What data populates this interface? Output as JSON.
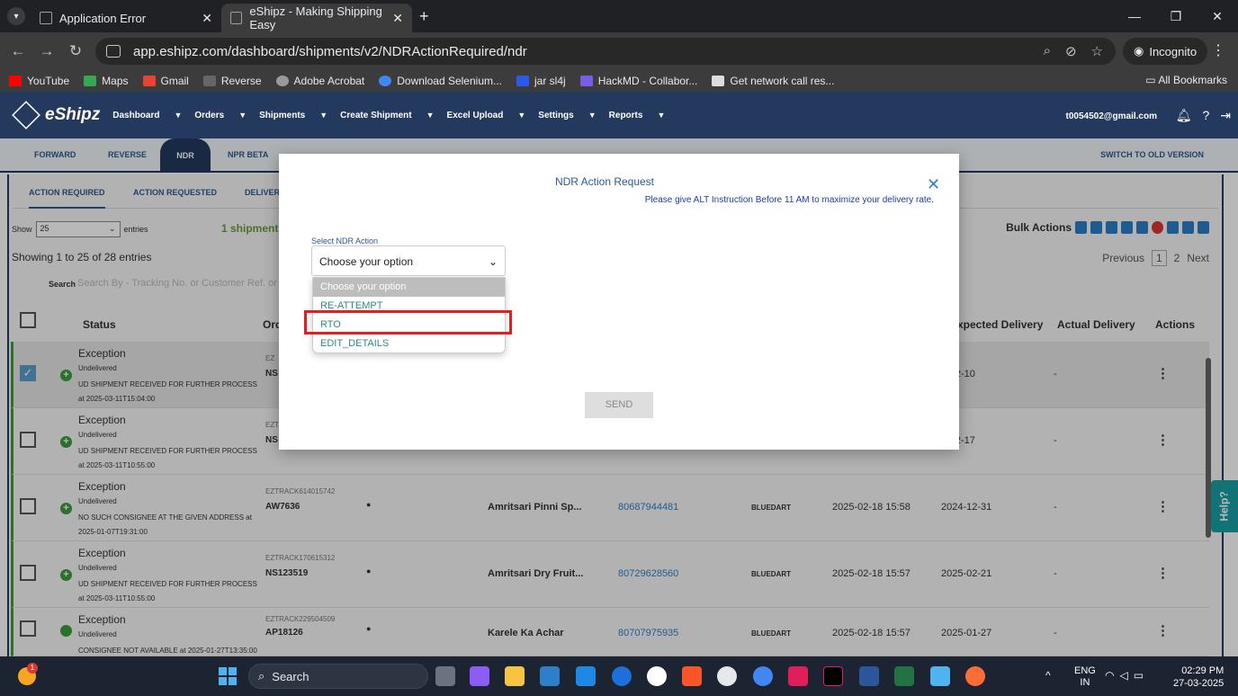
{
  "browser": {
    "tabs": [
      {
        "title": "Application Error",
        "active": false
      },
      {
        "title": "eShipz - Making Shipping Easy",
        "active": true
      }
    ],
    "new_tab": "+",
    "url": "app.eshipz.com/dashboard/shipments/v2/NDRActionRequired/ndr",
    "incognito_label": "Incognito",
    "bookmarks": [
      {
        "label": "YouTube",
        "color": "#ff0000"
      },
      {
        "label": "Maps",
        "color": "#34a853"
      },
      {
        "label": "Gmail",
        "color": "#ea4335"
      },
      {
        "label": "Reverse",
        "color": "#666666"
      },
      {
        "label": "Adobe Acrobat",
        "color": "#999999"
      },
      {
        "label": "Download Selenium...",
        "color": "#4285f4"
      },
      {
        "label": "jar sl4j",
        "color": "#2c5ae8"
      },
      {
        "label": "HackMD - Collabor...",
        "color": "#7b5ce8"
      },
      {
        "label": "Get network call res...",
        "color": "#dddddd"
      }
    ],
    "all_bookmarks": "All Bookmarks"
  },
  "app": {
    "brand": "eShipz",
    "menu": [
      "Dashboard",
      "Orders",
      "Shipments",
      "Create Shipment",
      "Excel Upload",
      "Settings",
      "Reports"
    ],
    "user_email": "t0054502@gmail.com",
    "tabs": [
      {
        "label": "FORWARD"
      },
      {
        "label": "REVERSE"
      },
      {
        "label": "NDR"
      },
      {
        "label": "NPR BETA"
      }
    ],
    "switch_label": "SWITCH TO OLD VERSION",
    "subtabs": [
      "ACTION REQUIRED",
      "ACTION REQUESTED",
      "DELIVERE"
    ],
    "show_label": "Show",
    "show_value": "25",
    "entries_label": "entries",
    "shipments_count": "1 shipments",
    "showing_text": "Showing 1 to 25 of 28 entries",
    "search_label": "Search",
    "search_placeholder": "Search By - Tracking No. or Customer Ref. or",
    "bulk_actions": "Bulk Actions",
    "pager": {
      "previous": "Previous",
      "page1": "1",
      "page2": "2",
      "next": "Next"
    },
    "columns": {
      "status": "Status",
      "order": "Orde",
      "expected": "xpected Delivery",
      "actual": "Actual Delivery",
      "actions": "Actions"
    },
    "rows": [
      {
        "status": "Exception",
        "sub": "Undelivered",
        "reason": "UD SHIPMENT RECEIVED FOR FURTHER PROCESS at 2025-03-11T15:04:00",
        "tracking": "EZ",
        "order": "NS",
        "product": "",
        "awb": "",
        "courier": "",
        "received": "",
        "expected": "5-02-10",
        "actual": "-",
        "checked": true
      },
      {
        "status": "Exception",
        "sub": "Undelivered",
        "reason": "UD SHIPMENT RECEIVED FOR FURTHER PROCESS at 2025-03-11T10:55:00",
        "tracking": "EZT",
        "order": "NS",
        "product": "",
        "awb": "",
        "courier": "",
        "received": "",
        "expected": "5-02-17",
        "actual": "-",
        "checked": false
      },
      {
        "status": "Exception",
        "sub": "Undelivered",
        "reason": "NO SUCH CONSIGNEE AT THE GIVEN ADDRESS at 2025-01-07T19:31:00",
        "tracking": "EZTRACK614015742",
        "order": "AW7636",
        "product": "Amritsari Pinni Sp...",
        "awb": "80687944481",
        "courier": "BLUEDART",
        "received": "2025-02-18 15:58",
        "expected": "2024-12-31",
        "actual": "-",
        "checked": false
      },
      {
        "status": "Exception",
        "sub": "Undelivered",
        "reason": "UD SHIPMENT RECEIVED FOR FURTHER PROCESS at 2025-03-11T10:55:00",
        "tracking": "EZTRACK170615312",
        "order": "NS123519",
        "product": "Amritsari Dry Fruit...",
        "awb": "80729628560",
        "courier": "BLUEDART",
        "received": "2025-02-18 15:57",
        "expected": "2025-02-21",
        "actual": "-",
        "checked": false
      },
      {
        "status": "Exception",
        "sub": "Undelivered",
        "reason": "CONSIGNEE NOT AVAILABLE at 2025-01-27T13:35:00",
        "tracking": "EZTRACK229504509",
        "order": "AP18126",
        "product": "Karele Ka Achar",
        "awb": "80707975935",
        "courier": "BLUEDART",
        "received": "2025-02-18 15:57",
        "expected": "2025-01-27",
        "actual": "-",
        "checked": false
      }
    ],
    "help": "Help?"
  },
  "modal": {
    "title": "NDR Action Request",
    "note": "Please give ALT Instruction Before 11 AM to maximize your delivery rate.",
    "select_label": "Select NDR Action",
    "select_value": "Choose your option",
    "options": [
      "Choose your option",
      "RE-ATTEMPT",
      "RTO",
      "EDIT_DETAILS"
    ],
    "highlighted_option": "RTO",
    "send": "SEND"
  },
  "taskbar": {
    "search": "Search",
    "lang1": "ENG",
    "lang2": "IN",
    "time": "02:29 PM",
    "date": "27-03-2025",
    "weather_badge": "1"
  }
}
